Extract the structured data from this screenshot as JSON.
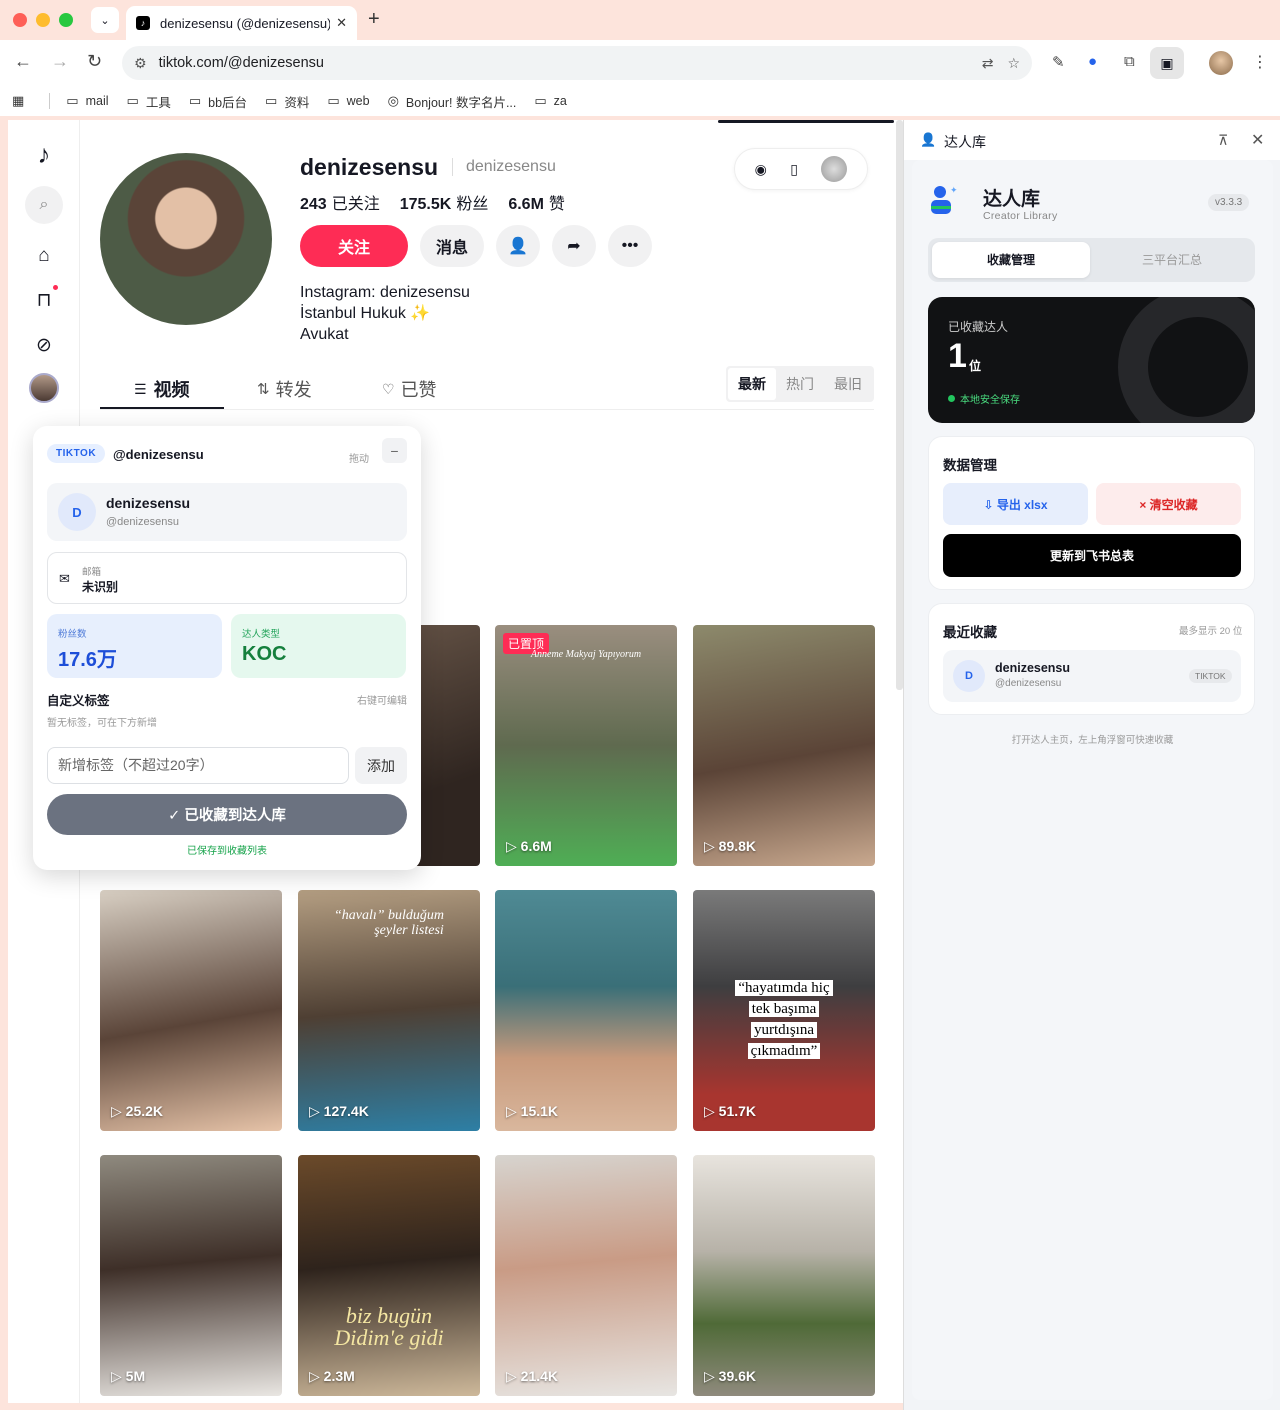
{
  "browser": {
    "tab_title": "denizesensu (@denizesensu)",
    "url": "tiktok.com/@denizesensu",
    "bookmarks": [
      "mail",
      "工具",
      "bb后台",
      "资料",
      "web",
      "Bonjour! 数字名片...",
      "za"
    ]
  },
  "profile": {
    "username": "denizesensu",
    "nickname": "denizesensu",
    "following_count": "243",
    "following_label": "已关注",
    "followers_count": "175.5K",
    "followers_label": "粉丝",
    "likes_count": "6.6M",
    "likes_label": "赞",
    "follow_label": "关注",
    "message_label": "消息",
    "bio_lines": [
      "Instagram: denizesensu",
      "İstanbul Hukuk ✨",
      "Avukat"
    ]
  },
  "tabs": {
    "videos": "视频",
    "reposts": "转发",
    "liked": "已赞",
    "sort": [
      "最新",
      "热门",
      "最旧"
    ]
  },
  "videos": [
    {
      "views": "6.6M",
      "pinned_label": "已置顶",
      "title": "Anneme Makyaj Yapıyorum"
    },
    {
      "views": "89.8K"
    },
    {
      "views": "25.2K"
    },
    {
      "views": "127.4K",
      "title_line1": "“havalı” bulduğum",
      "title_line2": "şeyler listesi"
    },
    {
      "views": "15.1K"
    },
    {
      "views": "51.7K",
      "caption": [
        "“hayatımda hiç",
        "tek başıma",
        "yurtdışına",
        "çıkmadım”"
      ]
    },
    {
      "views": "5M"
    },
    {
      "views": "2.3M",
      "title": "biz bugün Didim'e gidi"
    },
    {
      "views": "21.4K"
    },
    {
      "views": "39.6K"
    }
  ],
  "widget": {
    "platform": "TIKTOK",
    "handle": "@denizesensu",
    "drag_label": "拖动",
    "min_label": "−",
    "avatar_letter": "D",
    "name": "denizesensu",
    "sub": "@denizesensu",
    "email_label": "邮箱",
    "email_value": "未识别",
    "fans_label": "粉丝数",
    "fans_value": "17.6万",
    "type_label": "达人类型",
    "type_value": "KOC",
    "tags_title": "自定义标签",
    "tags_hint": "右键可编辑",
    "tags_empty": "暂无标签，可在下方新增",
    "tag_placeholder": "新增标签（不超过20字）",
    "add_label": "添加",
    "saved_button": "✓ 已收藏到达人库",
    "saved_hint": "已保存到收藏列表"
  },
  "side_panel": {
    "header_title": "达人库",
    "brand_title": "达人库",
    "brand_sub": "Creator Library",
    "version": "v3.3.3",
    "seg_manage": "收藏管理",
    "seg_summary": "三平台汇总",
    "saved_label": "已收藏达人",
    "saved_count": "1",
    "saved_unit": "位",
    "saved_status": "本地安全保存",
    "data_title": "数据管理",
    "export_label": "⇩ 导出 xlsx",
    "clear_label": "× 清空收藏",
    "update_label": "更新到飞书总表",
    "recent_title": "最近收藏",
    "recent_hint": "最多显示 20 位",
    "recent_avatar": "D",
    "recent_name": "denizesensu",
    "recent_sub": "@denizesensu",
    "recent_badge": "TIKTOK",
    "footer": "打开达人主页，左上角浮窗可快速收藏"
  },
  "colors": {
    "tiktok_red": "#fe2c55",
    "accent_blue": "#2563eb",
    "success_green": "#16a34a"
  }
}
